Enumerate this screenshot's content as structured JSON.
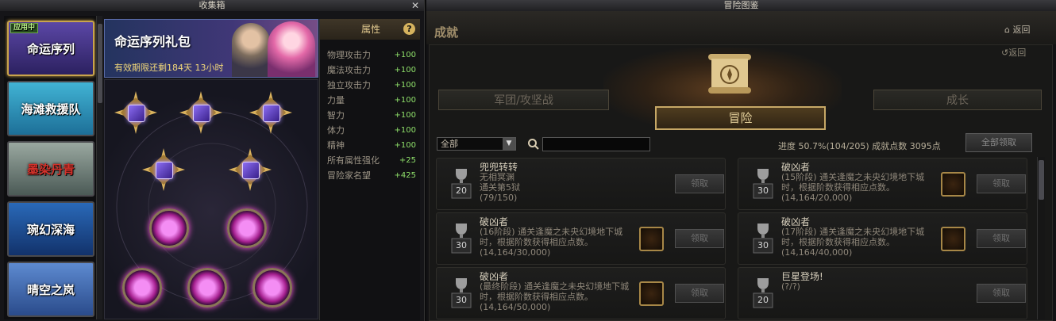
{
  "left_window": {
    "title": "收集箱",
    "close": "✕",
    "categories": [
      {
        "label": "命运序列",
        "badge": "应用中",
        "bg": "#4b3b8a"
      },
      {
        "label": "海滩救援队",
        "bg": "#2d8fb0"
      },
      {
        "label": "墨染丹青",
        "bg": "#6d7f79"
      },
      {
        "label": "琬幻深海",
        "bg": "#1f4e9a"
      },
      {
        "label": "晴空之岚",
        "bg": "#3566b0"
      }
    ],
    "banner": {
      "title": "命运序列礼包",
      "expiry": "有效期限还剩184天 13小时"
    },
    "attributes": {
      "header": "属性",
      "help": "?",
      "rows": [
        {
          "name": "物理攻击力",
          "value": "+100"
        },
        {
          "name": "魔法攻击力",
          "value": "+100"
        },
        {
          "name": "独立攻击力",
          "value": "+100"
        },
        {
          "name": "力量",
          "value": "+100"
        },
        {
          "name": "智力",
          "value": "+100"
        },
        {
          "name": "体力",
          "value": "+100"
        },
        {
          "name": "精神",
          "value": "+100"
        },
        {
          "name": "所有属性强化",
          "value": "+25"
        },
        {
          "name": "冒险家名望",
          "value": "+425"
        }
      ]
    }
  },
  "right_window": {
    "title": "冒险图鉴",
    "section": "成就",
    "home_back": "返回",
    "back": "返回",
    "tabs": {
      "left": "军团/攻坚战",
      "center": "冒险",
      "right": "成长"
    },
    "filter_value": "全部",
    "search_placeholder": "",
    "progress": "进度 50.7%(104/205)   成就点数 3095点",
    "claim_all": "全部领取",
    "cards": [
      {
        "name": "兜兜转转",
        "desc": "无相冥渊\n通关第5狱\n(79/150)",
        "points": "20",
        "claim": "领取",
        "reward": false
      },
      {
        "name": "破凶者",
        "desc": "(15阶段) 通关逢魔之未央幻境地下城时，根据阶数获得相应点数。\n(14,164/20,000)",
        "points": "30",
        "claim": "领取",
        "reward": true
      },
      {
        "name": "破凶者",
        "desc": "(16阶段) 通关逢魔之未央幻境地下城时，根据阶数获得相应点数。\n(14,164/30,000)",
        "points": "30",
        "claim": "领取",
        "reward": true
      },
      {
        "name": "破凶者",
        "desc": "(17阶段) 通关逢魔之未央幻境地下城时，根据阶数获得相应点数。\n(14,164/40,000)",
        "points": "30",
        "claim": "领取",
        "reward": true
      },
      {
        "name": "破凶者",
        "desc": "(最终阶段) 通关逢魔之未央幻境地下城时，根据阶数获得相应点数。\n(14,164/50,000)",
        "points": "30",
        "claim": "领取",
        "reward": true
      },
      {
        "name": "巨星登场!",
        "desc": "(?/?)",
        "points": "20",
        "claim": "领取",
        "reward": false
      }
    ]
  }
}
